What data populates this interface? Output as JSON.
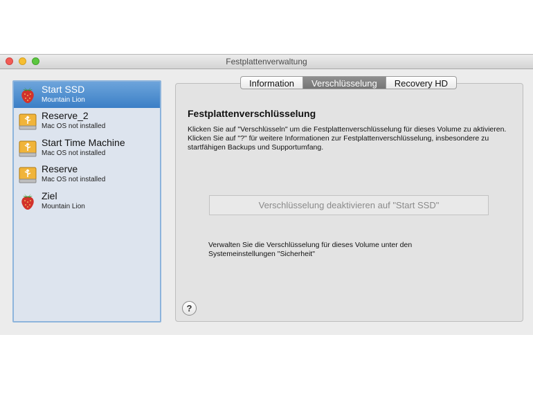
{
  "window": {
    "title": "Festplattenverwaltung"
  },
  "sidebar": {
    "items": [
      {
        "name": "Start SSD",
        "subtitle": "Mountain Lion",
        "icon": "strawberry-disk-icon",
        "selected": true
      },
      {
        "name": "Reserve_2",
        "subtitle": "Mac OS not installed",
        "icon": "usb-drive-icon",
        "selected": false
      },
      {
        "name": "Start Time Machine",
        "subtitle": "Mac OS not installed",
        "icon": "usb-drive-icon",
        "selected": false
      },
      {
        "name": "Reserve",
        "subtitle": "Mac OS not installed",
        "icon": "usb-drive-icon",
        "selected": false
      },
      {
        "name": "Ziel",
        "subtitle": "Mountain Lion",
        "icon": "strawberry-disk-icon",
        "selected": false
      }
    ]
  },
  "tabs": [
    {
      "label": "Information",
      "active": false
    },
    {
      "label": "Verschlüsselung",
      "active": true
    },
    {
      "label": "Recovery HD",
      "active": false
    }
  ],
  "main": {
    "heading": "Festplattenverschlüsselung",
    "description": "Klicken Sie auf \"Verschlüsseln\" um die Festplattenverschlüsselung für dieses Volume zu aktivieren. Klicken Sie auf \"?\" für weitere Informationen zur Festplattenverschlüsselung, insbesondere zu startfähigen Backups und Supportumfang.",
    "button_label": "Verschlüsselung deaktivieren auf \"Start SSD\"",
    "note": "Verwalten Sie die Verschlüsselung für dieses Volume unter den Systemeinstellungen \"Sicherheit\"",
    "help_label": "?"
  },
  "colors": {
    "selection": "#3b7fc6",
    "sidebar_bg": "#dde4ee"
  }
}
